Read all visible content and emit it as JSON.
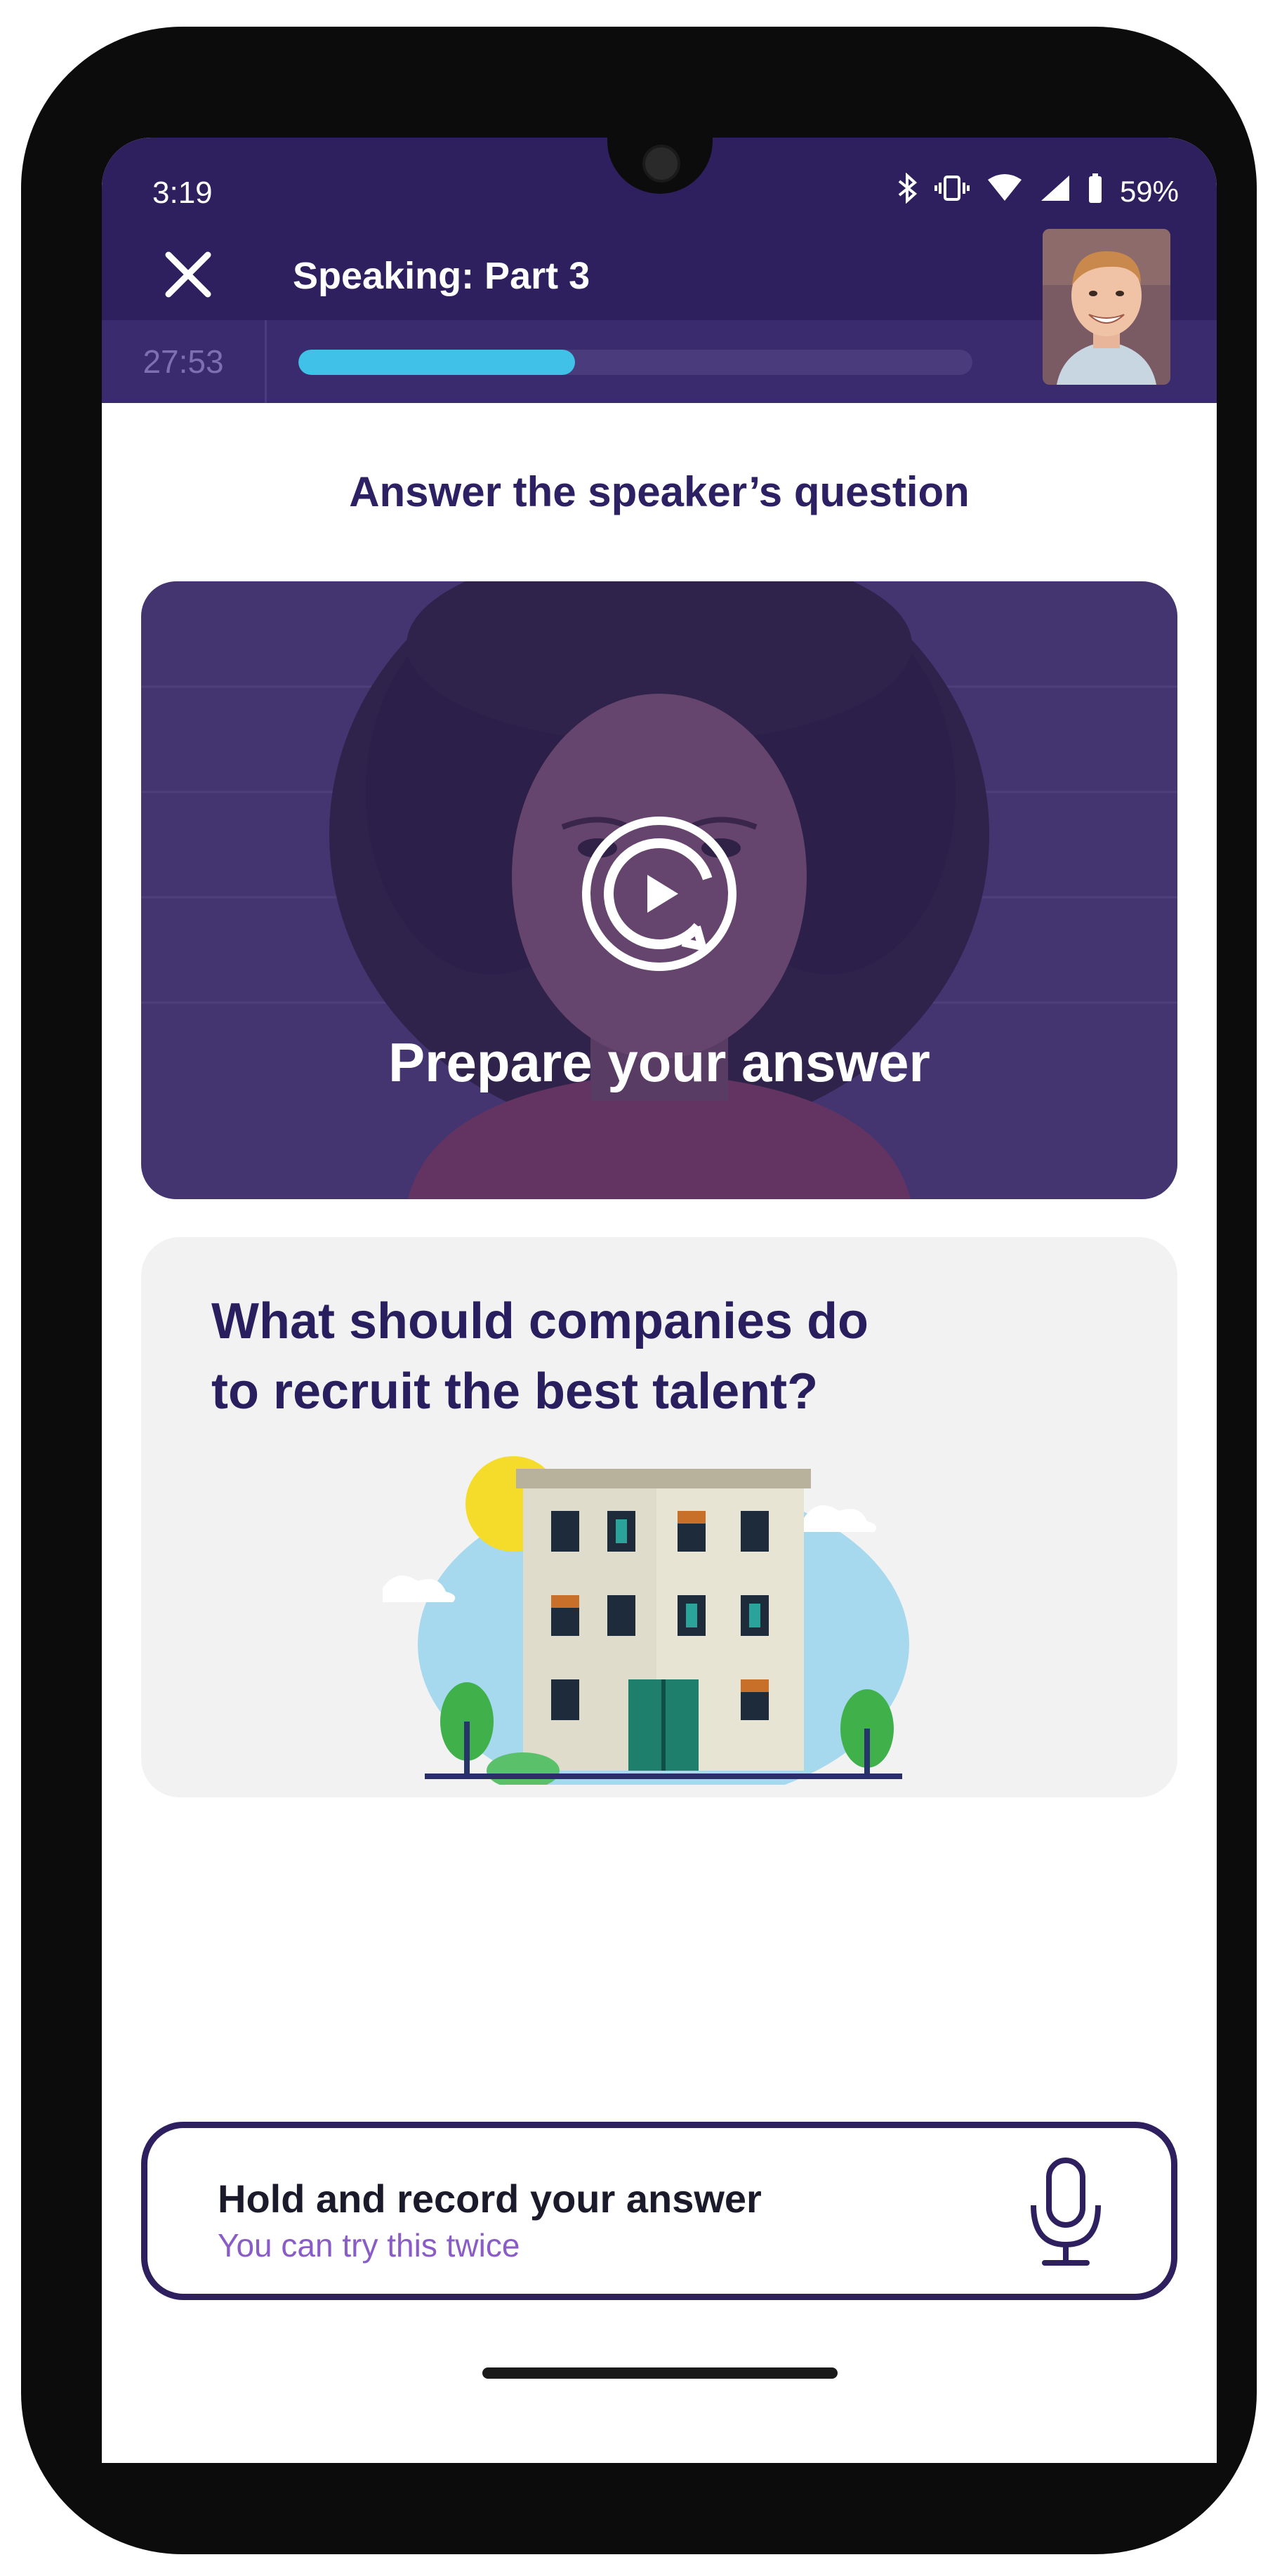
{
  "status_bar": {
    "time": "3:19",
    "battery": "59%",
    "icons": [
      "bluetooth-icon",
      "vibrate-icon",
      "wifi-icon",
      "signal-icon",
      "battery-icon"
    ]
  },
  "header": {
    "title": "Speaking: Part 3",
    "close_icon": "close-icon",
    "timer": "27:53",
    "progress": 0.41
  },
  "main": {
    "instruction": "Answer the speaker’s question",
    "video": {
      "caption": "Prepare your answer",
      "play_icon": "replay-play-icon"
    },
    "question": {
      "text_line1": "What should companies do",
      "text_line2": "to recruit the best talent?"
    }
  },
  "record": {
    "title": "Hold and record your answer",
    "subtitle": "You can try this twice",
    "icon": "microphone-icon"
  },
  "colors": {
    "header_bg": "#2e1f5f",
    "progress_fill": "#3fc1e8",
    "accent_text": "#2e2163",
    "subtitle_purple": "#8a5cc7"
  }
}
